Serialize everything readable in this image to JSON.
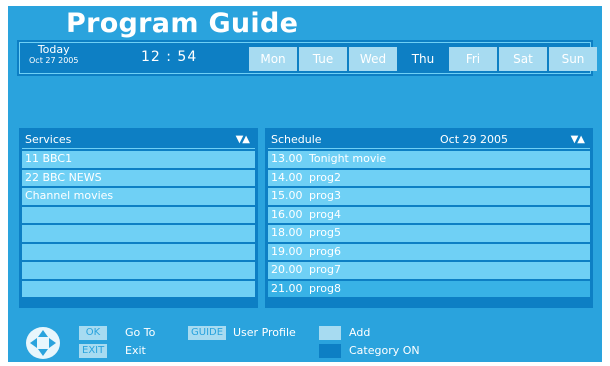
{
  "title": "Program Guide",
  "date_bar": {
    "today_label": "Today",
    "today_date": "Oct 27  2005",
    "clock": "12 : 54",
    "days": [
      {
        "label": "Mon",
        "active": false
      },
      {
        "label": "Tue",
        "active": false
      },
      {
        "label": "Wed",
        "active": false
      },
      {
        "label": "Thu",
        "active": true
      },
      {
        "label": "Fri",
        "active": false
      },
      {
        "label": "Sat",
        "active": false
      },
      {
        "label": "Sun",
        "active": false
      }
    ]
  },
  "services": {
    "header": "Services",
    "sort_icon": "sort-arrows-icon",
    "rows": [
      "11 BBC1",
      "22 BBC NEWS",
      "Channel movies",
      "",
      "",
      "",
      "",
      ""
    ]
  },
  "schedule": {
    "header": "Schedule",
    "date": "Oct 29  2005",
    "sort_icon": "sort-arrows-icon",
    "rows": [
      {
        "time": "13.00",
        "title": "Tonight movie"
      },
      {
        "time": "14.00",
        "title": "prog2"
      },
      {
        "time": "15.00",
        "title": "prog3"
      },
      {
        "time": "16.00",
        "title": "prog4"
      },
      {
        "time": "18.00",
        "title": "prog5"
      },
      {
        "time": "19.00",
        "title": "prog6"
      },
      {
        "time": "20.00",
        "title": "prog7"
      },
      {
        "time": "21.00",
        "title": "prog8"
      }
    ],
    "selected_index": 7
  },
  "footer": {
    "dpad_icon": "dpad-icon",
    "ok_key": "OK",
    "ok_action": "Go To",
    "exit_key": "EXIT",
    "exit_action": "Exit",
    "guide_key": "GUIDE",
    "guide_action": "User Profile",
    "add_label": "Add",
    "category_label": "Category ON"
  },
  "colors": {
    "background": "#2aa3dd",
    "panel": "#0d7fc4",
    "row": "#6fd0f5",
    "day_inactive": "#a7dbf1",
    "swatch_light": "#a7dbf1",
    "swatch_dark": "#0d7fc4"
  }
}
